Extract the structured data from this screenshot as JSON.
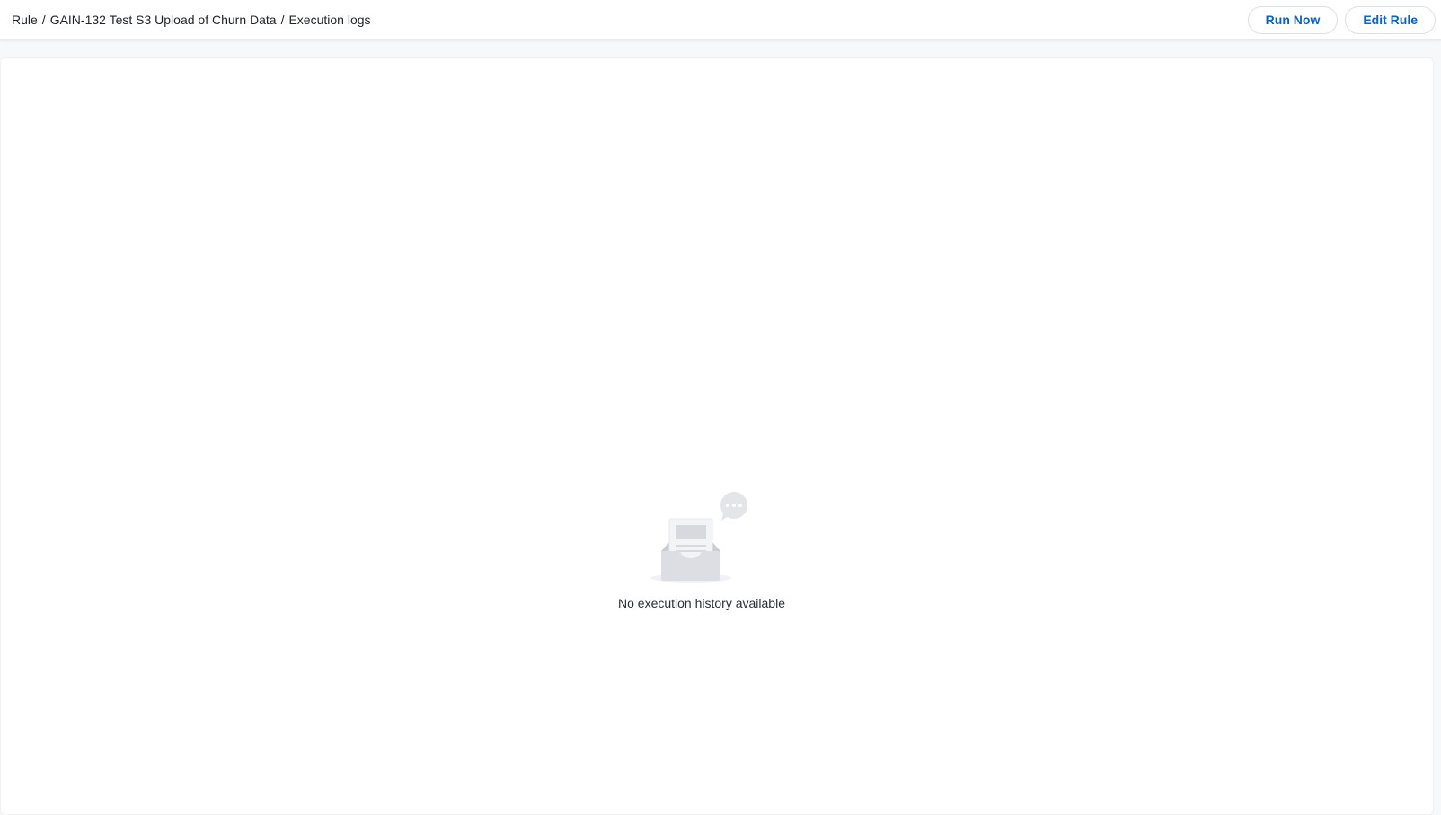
{
  "header": {
    "breadcrumb": [
      {
        "label": "Rule"
      },
      {
        "label": "GAIN-132 Test S3 Upload of Churn Data"
      },
      {
        "label": "Execution logs"
      }
    ],
    "separator": "/",
    "actions": {
      "run_now_label": "Run Now",
      "edit_rule_label": "Edit Rule"
    }
  },
  "main": {
    "empty_state": {
      "icon": "empty-inbox-icon",
      "message": "No execution history available"
    }
  },
  "colors": {
    "accent": "#0b62c4",
    "page_background": "#f7f8fa",
    "panel_background": "#ffffff",
    "illustration_gray": "#e3e5e9"
  }
}
